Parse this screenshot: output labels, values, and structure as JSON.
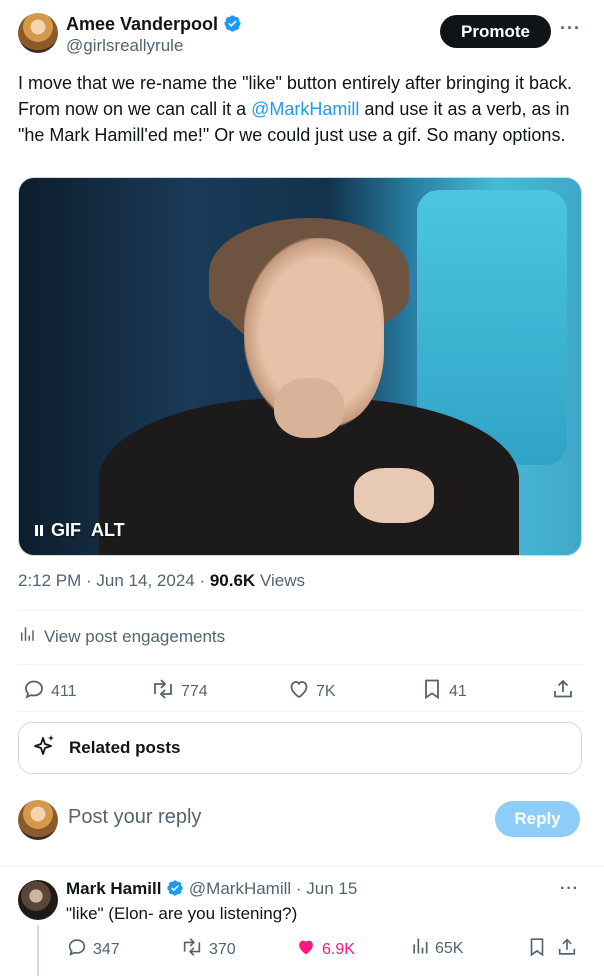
{
  "post": {
    "author_name": "Amee Vanderpool",
    "author_handle": "@girlsreallyrule",
    "promote_label": "Promote",
    "more_label": "···",
    "text_before": "I move that we re-name the \"like\" button entirely after bringing it back. From now on we can call it a ",
    "mention": "@MarkHamill",
    "text_after": " and use it as a verb, as in \"he Mark Hamill'ed me!\" Or we could just use a gif. So many options.",
    "media": {
      "badge_gif": "GIF",
      "badge_alt": "ALT"
    },
    "time": "2:12 PM",
    "dot1": " · ",
    "date": "Jun 14, 2024",
    "dot2": " · ",
    "views_count": "90.6K",
    "views_label": " Views",
    "engagements_label": "View post engagements",
    "stats": {
      "replies": "411",
      "reposts": "774",
      "likes": "7K",
      "bookmarks": "41"
    }
  },
  "related_posts_label": "Related posts",
  "composer": {
    "placeholder": "Post your reply",
    "reply_button": "Reply"
  },
  "reply": {
    "author_name": "Mark Hamill",
    "author_handle": "@MarkHamill",
    "dot": " · ",
    "date": "Jun 15",
    "more_label": "···",
    "text": "\"like\" (Elon- are you listening?)",
    "stats": {
      "replies": "347",
      "reposts": "370",
      "likes": "6.9K",
      "views": "65K"
    },
    "like_color": "#f91880"
  },
  "colors": {
    "accent": "#1d9bf0",
    "verified": "#1d9bf0",
    "muted": "#536471"
  }
}
